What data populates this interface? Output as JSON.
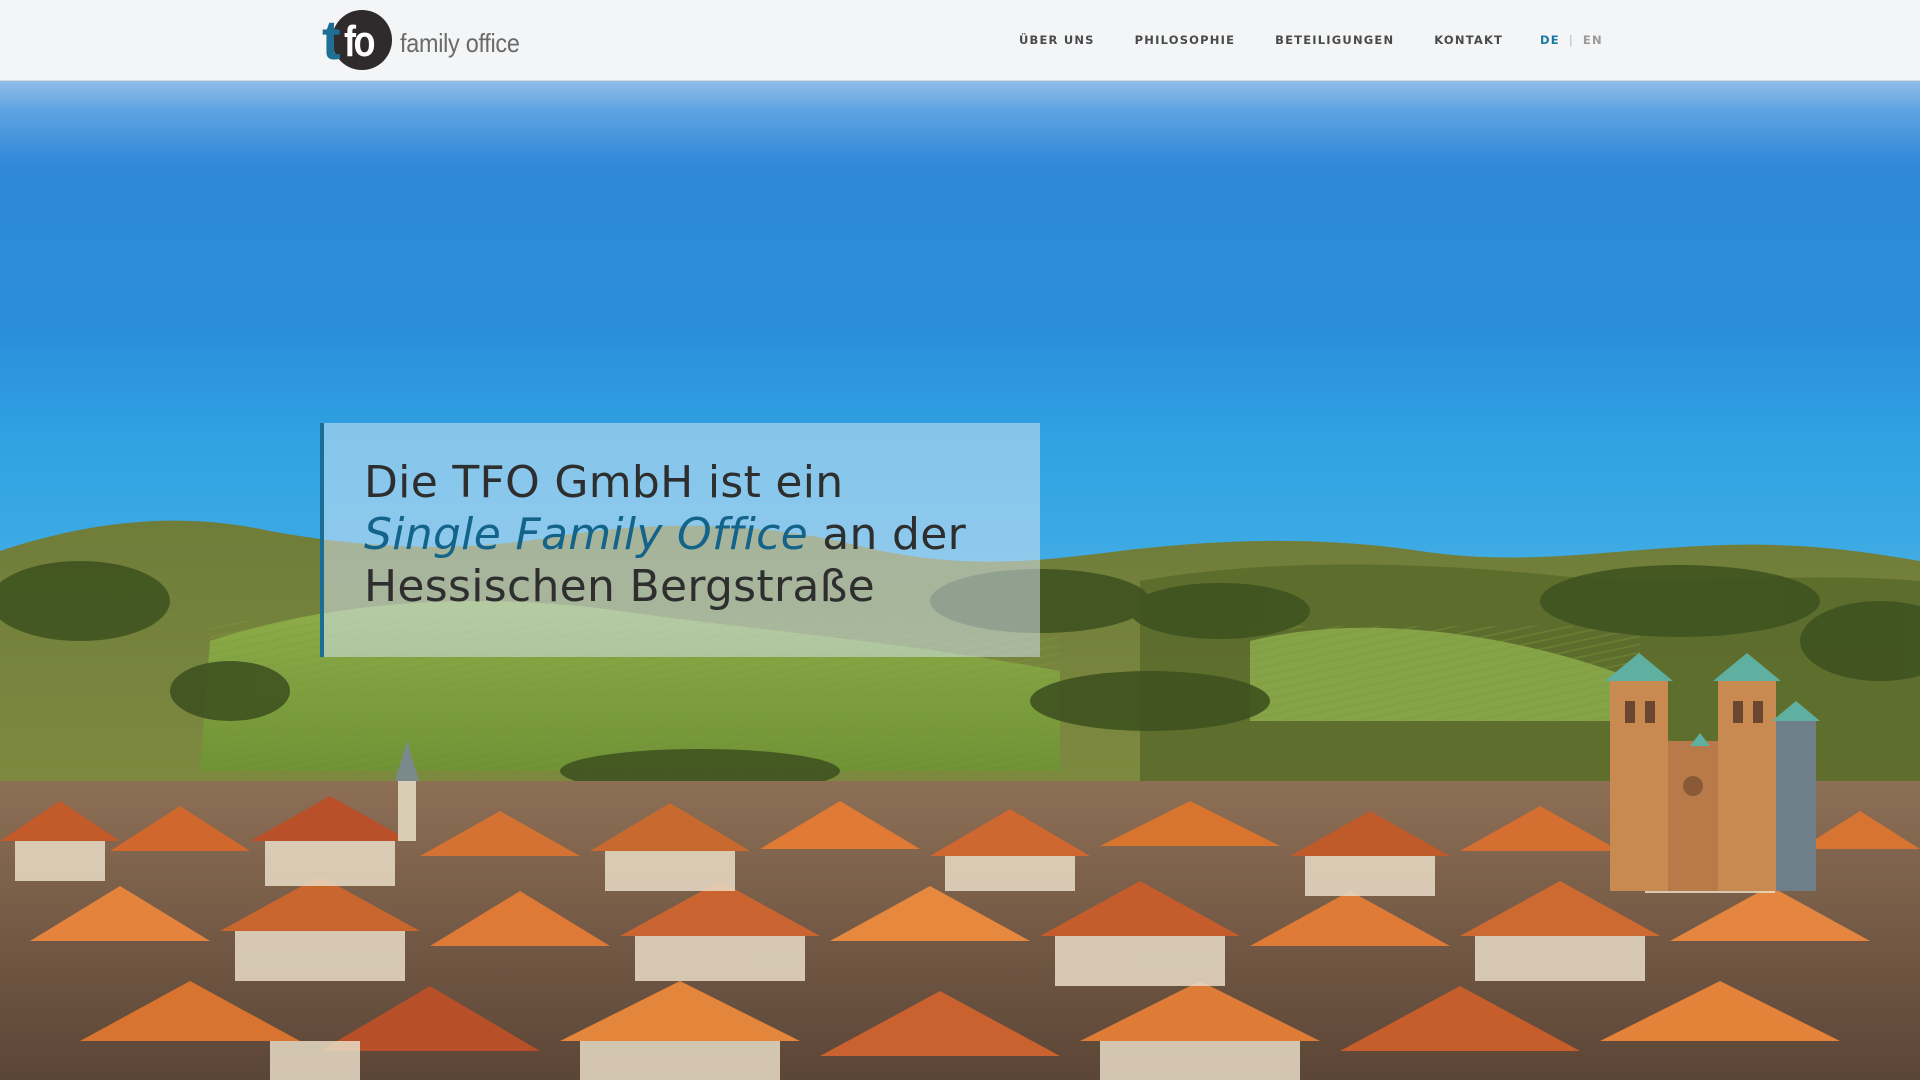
{
  "header": {
    "logo": {
      "mark_t": "t",
      "mark_fo": "fo",
      "text": "family office"
    },
    "nav": [
      {
        "label": "ÜBER UNS"
      },
      {
        "label": "PHILOSOPHIE"
      },
      {
        "label": "BETEILIGUNGEN"
      },
      {
        "label": "KONTAKT"
      }
    ],
    "language": {
      "active": "DE",
      "separator": "|",
      "other": "EN"
    }
  },
  "hero": {
    "image_description_icon": "landscape-photo-icon",
    "headline": {
      "line1": "Die TFO GmbH ist ein",
      "emphasis": "Single Family Office",
      "line2_rest": " an der",
      "line3": "Hessischen Bergstraße"
    }
  },
  "colors": {
    "accent": "#1a7aa6",
    "emphasis_text": "#13638a",
    "header_bg": "#f4f5f6",
    "nav_text": "#4a4a4a",
    "panel_border": "#1a6e96"
  }
}
